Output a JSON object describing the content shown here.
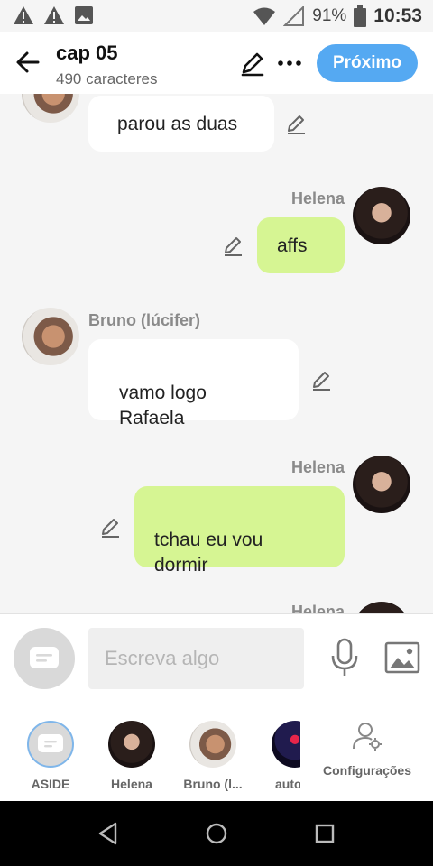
{
  "status_bar": {
    "battery": "91%",
    "time": "10:53"
  },
  "header": {
    "title": "cap 05",
    "subtitle": "490 caracteres",
    "next_label": "Próximo"
  },
  "messages": [
    {
      "sender": "",
      "text": "parou as duas",
      "side": "left",
      "avatar": "bruno"
    },
    {
      "sender": "Helena",
      "text": "affs",
      "side": "right",
      "avatar": "helena"
    },
    {
      "sender": "Bruno (lúcifer)",
      "text": "vamo logo\nRafaela",
      "side": "left",
      "avatar": "bruno"
    },
    {
      "sender": "Helena",
      "text": "tchau eu vou\ndormir",
      "side": "right",
      "avatar": "helena"
    },
    {
      "sender": "Helena",
      "text": "",
      "side": "right",
      "avatar": "helena"
    }
  ],
  "composer": {
    "placeholder": "Escreva algo"
  },
  "characters": [
    {
      "label": "ASIDE"
    },
    {
      "label": "Helena"
    },
    {
      "label": "Bruno (l..."
    },
    {
      "label": "auto"
    }
  ],
  "settings_label": "Configurações",
  "colors": {
    "accent": "#55a9f2",
    "bubble_right": "#d6f593",
    "bubble_left": "#ffffff"
  }
}
